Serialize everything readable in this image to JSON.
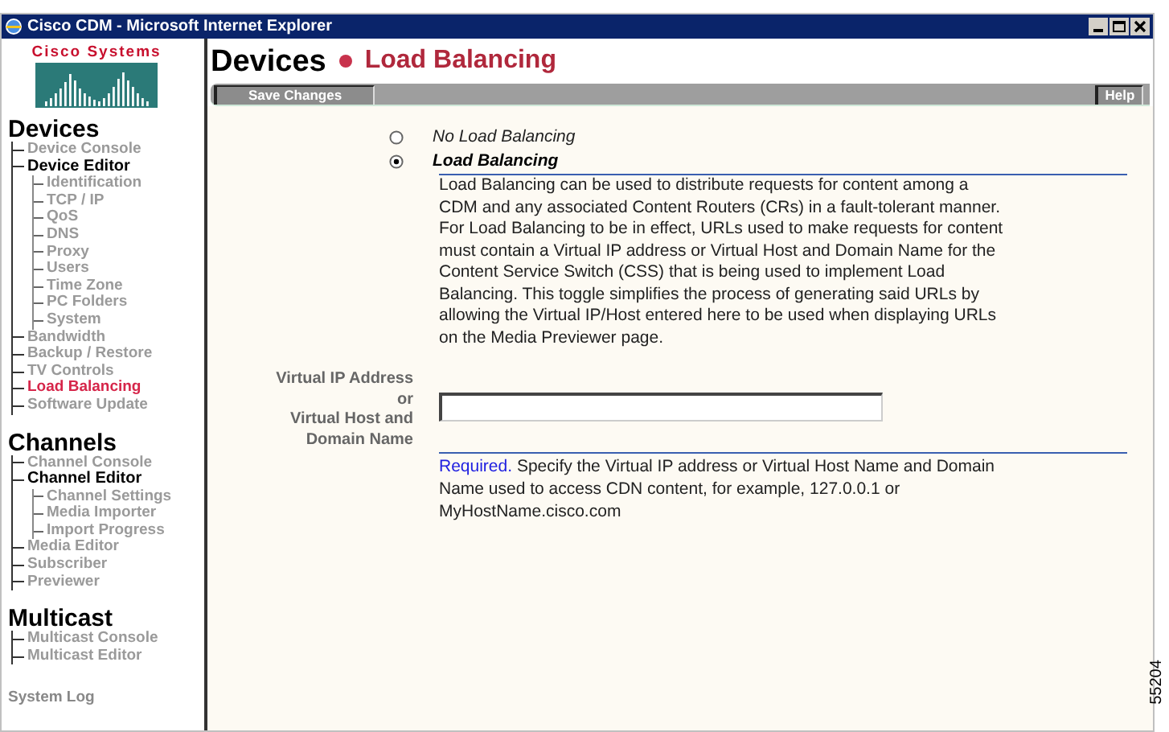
{
  "window": {
    "title": "Cisco CDM - Microsoft Internet Explorer"
  },
  "logo": {
    "text": "Cisco Systems"
  },
  "header": {
    "section": "Devices",
    "page": "Load Balancing"
  },
  "toolbar": {
    "buttons": [
      {
        "label": "Save Changes"
      },
      {
        "label": "Help"
      }
    ]
  },
  "sidebar": {
    "groups": [
      {
        "title": "Devices",
        "items": [
          {
            "label": "Device Console",
            "selected": false,
            "expanded": false
          },
          {
            "label": "Device Editor",
            "selected": false,
            "expanded": true,
            "children": [
              {
                "label": "Identification",
                "selected": false
              },
              {
                "label": "TCP / IP",
                "selected": false
              },
              {
                "label": "QoS",
                "selected": false
              },
              {
                "label": "DNS",
                "selected": false
              },
              {
                "label": "Proxy",
                "selected": false
              },
              {
                "label": "Users",
                "selected": false
              },
              {
                "label": "Time Zone",
                "selected": false
              },
              {
                "label": "PC Folders",
                "selected": false
              },
              {
                "label": "System",
                "selected": false
              }
            ]
          },
          {
            "label": "Bandwidth",
            "selected": false,
            "expanded": false
          },
          {
            "label": "Backup / Restore",
            "selected": false,
            "expanded": false
          },
          {
            "label": "TV Controls",
            "selected": false,
            "expanded": false
          },
          {
            "label": "Load Balancing",
            "selected": true,
            "expanded": false
          },
          {
            "label": "Software Update",
            "selected": false,
            "expanded": false
          }
        ]
      },
      {
        "title": "Channels",
        "items": [
          {
            "label": "Channel Console",
            "selected": false,
            "expanded": false
          },
          {
            "label": "Channel Editor",
            "selected": false,
            "expanded": true,
            "children": [
              {
                "label": "Channel Settings",
                "selected": false
              },
              {
                "label": "Media Importer",
                "selected": false
              },
              {
                "label": "Import Progress",
                "selected": false
              }
            ]
          },
          {
            "label": "Media Editor",
            "selected": false,
            "expanded": false
          },
          {
            "label": "Subscriber",
            "selected": false,
            "expanded": false
          },
          {
            "label": "Previewer",
            "selected": false,
            "expanded": false
          }
        ]
      },
      {
        "title": "Multicast",
        "items": [
          {
            "label": "Multicast Console",
            "selected": false,
            "expanded": false
          },
          {
            "label": "Multicast Editor",
            "selected": false,
            "expanded": false
          }
        ]
      }
    ],
    "footer": "System Log"
  },
  "options": [
    {
      "label": "No Load Balancing",
      "selected": false
    },
    {
      "label": "Load Balancing",
      "selected": true
    }
  ],
  "description": "Load Balancing can be used to distribute requests for content among a CDM and any associated Content Routers (CRs) in a fault-tolerant manner. For Load Balancing to be in effect, URLs used to make requests for content must contain a Virtual IP address or Virtual Host and Domain Name for the Content Service Switch (CSS) that is being used to implement Load Balancing. This toggle simplifies the process of generating said URLs by allowing the Virtual IP/Host entered here to be used when displaying URLs on the Media Previewer page.",
  "field": {
    "label_lines": [
      "Virtual IP Address",
      "or",
      "Virtual Host and",
      "Domain Name"
    ],
    "required": "Required.",
    "help": "Specify the Virtual IP address or Virtual Host Name and Domain Name used to access CDN content, for example, 127.0.0.1 or MyHostName.cisco.com"
  },
  "figure_number": "55204"
}
